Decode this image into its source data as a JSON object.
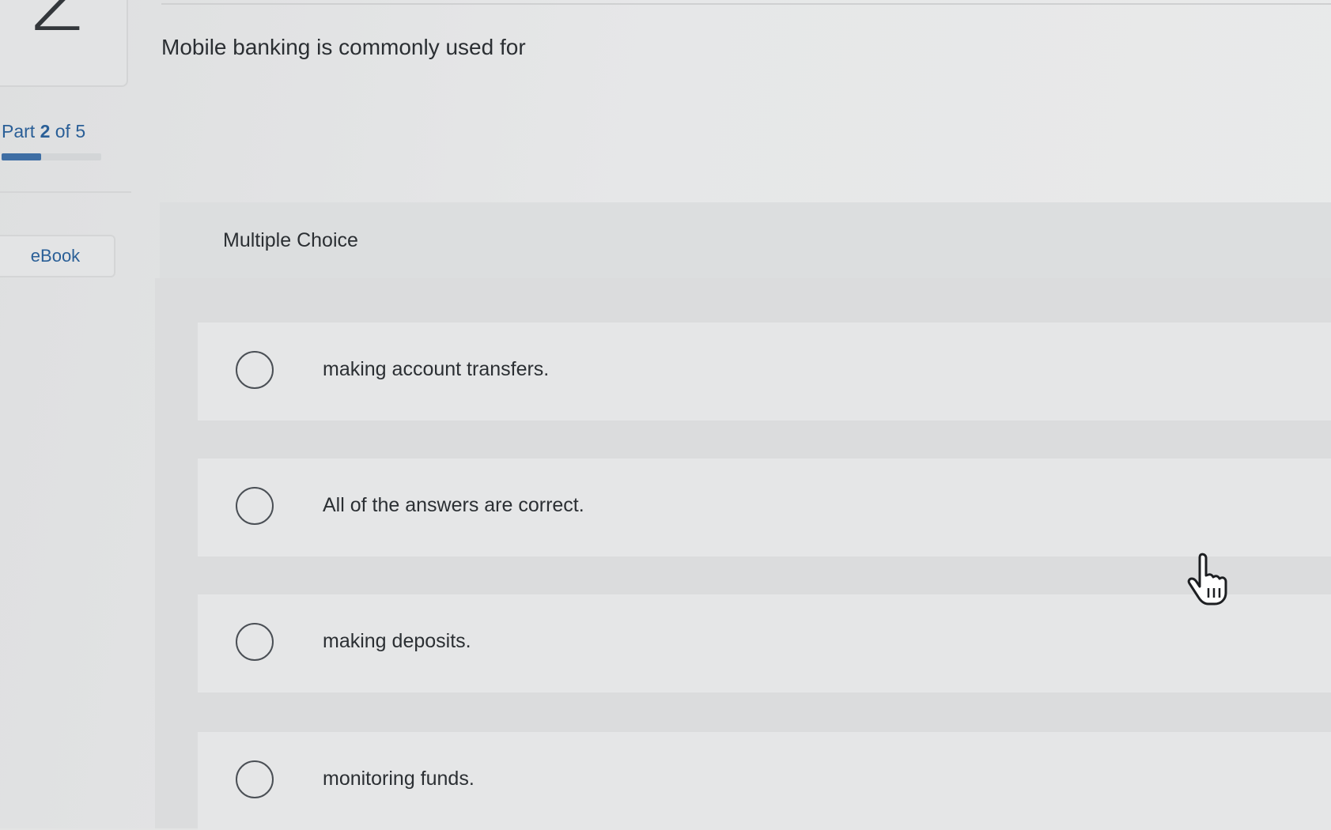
{
  "question_number": "2",
  "progress": {
    "part_word": "Part",
    "part_current": "2",
    "part_suffix": "of 5",
    "fraction": 0.4
  },
  "sidebar": {
    "ebook_label": "eBook"
  },
  "question": {
    "text": "Mobile banking is commonly used for"
  },
  "multiple_choice": {
    "title": "Multiple Choice",
    "options": [
      {
        "label": "making account transfers.",
        "selected": false
      },
      {
        "label": "All of the answers are correct.",
        "selected": false
      },
      {
        "label": "making deposits.",
        "selected": false
      },
      {
        "label": "monitoring funds.",
        "selected": false
      }
    ]
  },
  "colors": {
    "accent": "#2a5f97",
    "progress_fill": "#3e6ea4",
    "background": "#e3e4e4"
  },
  "cursor": {
    "icon": "hand-pointer-icon"
  }
}
